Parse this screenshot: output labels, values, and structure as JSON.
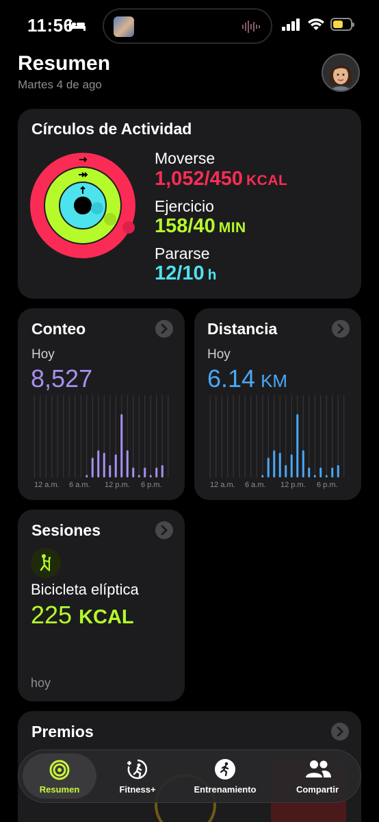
{
  "status_bar": {
    "time": "11:56"
  },
  "header": {
    "title": "Resumen",
    "date": "Martes 4 de ago"
  },
  "activity": {
    "title": "Círculos de Actividad",
    "move": {
      "label": "Moverse",
      "value": "1,052/450",
      "unit": "KCAL",
      "color": "#fa2c55",
      "progress": 2.34
    },
    "exercise": {
      "label": "Ejercicio",
      "value": "158/40",
      "unit": "MIN",
      "color": "#b5fb2b",
      "progress": 3.95
    },
    "stand": {
      "label": "Pararse",
      "value": "12/10",
      "unit": "h",
      "color": "#4de3ee",
      "progress": 1.2
    }
  },
  "steps_card": {
    "title": "Conteo",
    "period": "Hoy",
    "value": "8,527",
    "color": "#a990f0",
    "ticks": [
      "12 a.m.",
      "6 a.m.",
      "12 p.m.",
      "6 p.m."
    ]
  },
  "distance_card": {
    "title": "Distancia",
    "period": "Hoy",
    "value": "6.14",
    "unit": "KM",
    "color": "#4aa8f7",
    "ticks": [
      "12 a.m.",
      "6 a.m.",
      "12 p.m.",
      "6 p.m."
    ]
  },
  "chart_data": [
    {
      "type": "bar",
      "x": [
        0,
        1,
        2,
        3,
        4,
        5,
        6,
        7,
        8,
        9,
        10,
        11,
        12,
        13,
        14,
        15,
        16,
        17,
        18,
        19,
        20,
        21,
        22,
        23
      ],
      "values": [
        0,
        0,
        0,
        0,
        0,
        0,
        0,
        0,
        0,
        0.03,
        0.24,
        0.33,
        0.3,
        0.15,
        0.28,
        0.77,
        0.33,
        0.12,
        0.03,
        0.12,
        0.03,
        0.12,
        0.15,
        0
      ],
      "xticks": [
        "12 a.m.",
        "6 a.m.",
        "12 p.m.",
        "6 p.m."
      ]
    },
    {
      "type": "bar",
      "x": [
        0,
        1,
        2,
        3,
        4,
        5,
        6,
        7,
        8,
        9,
        10,
        11,
        12,
        13,
        14,
        15,
        16,
        17,
        18,
        19,
        20,
        21,
        22,
        23
      ],
      "values": [
        0,
        0,
        0,
        0,
        0,
        0,
        0,
        0,
        0,
        0.03,
        0.24,
        0.33,
        0.3,
        0.15,
        0.28,
        0.77,
        0.33,
        0.12,
        0.03,
        0.12,
        0.03,
        0.12,
        0.15,
        0
      ],
      "xticks": [
        "12 a.m.",
        "6 a.m.",
        "12 p.m.",
        "6 p.m."
      ]
    }
  ],
  "sessions_card": {
    "title": "Sesiones",
    "workout": "Bicicleta elíptica",
    "value": "225",
    "unit": "KCAL",
    "color": "#b5fb2b",
    "when": "hoy"
  },
  "awards_card": {
    "title": "Premios"
  },
  "tabs": [
    {
      "label": "Resumen",
      "icon": "rings-icon",
      "active": true
    },
    {
      "label": "Fitness+",
      "icon": "fitness-plus-icon",
      "active": false
    },
    {
      "label": "Entrenamiento",
      "icon": "running-icon",
      "active": false
    },
    {
      "label": "Compartir",
      "icon": "people-icon",
      "active": false
    }
  ]
}
